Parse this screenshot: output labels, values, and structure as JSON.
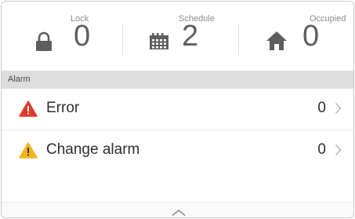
{
  "status": {
    "lock": {
      "label": "Lock",
      "count": "0",
      "icon": "lock-icon"
    },
    "schedule": {
      "label": "Schedule",
      "count": "2",
      "icon": "calendar-icon"
    },
    "occupied": {
      "label": "Occupied",
      "count": "0",
      "icon": "home-icon"
    }
  },
  "alarm_section": {
    "title": "Alarm",
    "items": [
      {
        "label": "Error",
        "count": "0",
        "icon": "error-warning-icon",
        "icon_color": "#e03a2c"
      },
      {
        "label": "Change alarm",
        "count": "0",
        "icon": "caution-warning-icon",
        "icon_color": "#f2b51d"
      }
    ]
  },
  "footer": {
    "icon": "chevron-up-icon"
  },
  "colors": {
    "header_bg": "#dddddd",
    "icon_gray": "#5e5e5e",
    "error_red": "#e03a2c",
    "warning_yellow": "#f2b51d"
  }
}
